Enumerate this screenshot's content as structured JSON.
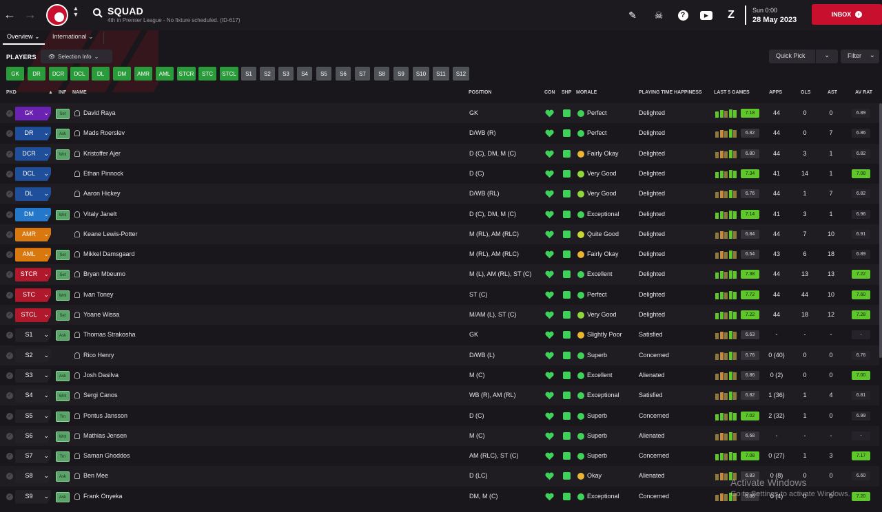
{
  "header": {
    "title": "SQUAD",
    "subtitle": "4th in Premier League - No fixture scheduled. (ID-617)",
    "day_time": "Sun 0:00",
    "date": "28 May 2023",
    "inbox_label": "INBOX"
  },
  "tabs": [
    {
      "label": "Overview"
    },
    {
      "label": "International"
    }
  ],
  "players_label": "PLAYERS",
  "selection_info": "Selection Info",
  "quick_pick": "Quick Pick",
  "filter": "Filter",
  "chips": [
    "GK",
    "DR",
    "DCR",
    "DCL",
    "DL",
    "DM",
    "AMR",
    "AML",
    "STCR",
    "STC",
    "STCL",
    "S1",
    "S2",
    "S3",
    "S4",
    "S5",
    "S6",
    "S7",
    "S8",
    "S9",
    "S10",
    "S11",
    "S12"
  ],
  "columns": {
    "pkd": "PKD",
    "inf": "INF",
    "name": "NAME",
    "position": "POSITION",
    "con": "CON",
    "shp": "SHP",
    "morale": "MORALE",
    "pth": "PLAYING TIME HAPPINESS",
    "last5": "LAST 5 GAMES",
    "apps": "APPS",
    "gls": "GLS",
    "ast": "AST",
    "avrat": "AV RAT"
  },
  "players": [
    {
      "role": "GK",
      "role_color": "#6a22b3",
      "inf": "Set",
      "name": "David Raya",
      "position": "GK",
      "morale": "Perfect",
      "mor_color": "#3fd25a",
      "pth": "Delighted",
      "last5": "7.18",
      "last5_hi": true,
      "apps": "44",
      "gls": "0",
      "ast": "0",
      "avrat": "6.89",
      "avrat_hi": false
    },
    {
      "role": "DR",
      "role_color": "#1f4f9a",
      "inf": "Ask",
      "name": "Mads Roerslev",
      "position": "D/WB (R)",
      "morale": "Perfect",
      "mor_color": "#3fd25a",
      "pth": "Delighted",
      "last5": "6.82",
      "last5_hi": false,
      "apps": "44",
      "gls": "0",
      "ast": "7",
      "avrat": "6.86",
      "avrat_hi": false
    },
    {
      "role": "DCR",
      "role_color": "#1f4f9a",
      "inf": "Wnt",
      "name": "Kristoffer Ajer",
      "position": "D (C), DM, M (C)",
      "morale": "Fairly Okay",
      "mor_color": "#e9b533",
      "pth": "Delighted",
      "last5": "6.80",
      "last5_hi": false,
      "apps": "44",
      "gls": "3",
      "ast": "1",
      "avrat": "6.82",
      "avrat_hi": false
    },
    {
      "role": "DCL",
      "role_color": "#1f4f9a",
      "inf": "",
      "name": "Ethan Pinnock",
      "position": "D (C)",
      "morale": "Very Good",
      "mor_color": "#8fd63a",
      "pth": "Delighted",
      "last5": "7.34",
      "last5_hi": true,
      "apps": "41",
      "gls": "14",
      "ast": "1",
      "avrat": "7.08",
      "avrat_hi": true
    },
    {
      "role": "DL",
      "role_color": "#1f4f9a",
      "inf": "",
      "name": "Aaron Hickey",
      "position": "D/WB (RL)",
      "morale": "Very Good",
      "mor_color": "#8fd63a",
      "pth": "Delighted",
      "last5": "6.76",
      "last5_hi": false,
      "apps": "44",
      "gls": "1",
      "ast": "7",
      "avrat": "6.82",
      "avrat_hi": false
    },
    {
      "role": "DM",
      "role_color": "#2577c9",
      "inf": "Wnt",
      "name": "Vitaly Janelt",
      "position": "D (C), DM, M (C)",
      "morale": "Exceptional",
      "mor_color": "#3fd25a",
      "pth": "Delighted",
      "last5": "7.14",
      "last5_hi": true,
      "apps": "41",
      "gls": "3",
      "ast": "1",
      "avrat": "6.96",
      "avrat_hi": false
    },
    {
      "role": "AMR",
      "role_color": "#d9780e",
      "inf": "",
      "name": "Keane Lewis-Potter",
      "position": "M (RL), AM (RLC)",
      "morale": "Quite Good",
      "mor_color": "#c9d636",
      "pth": "Delighted",
      "last5": "6.84",
      "last5_hi": false,
      "apps": "44",
      "gls": "7",
      "ast": "10",
      "avrat": "6.91",
      "avrat_hi": false
    },
    {
      "role": "AML",
      "role_color": "#d9780e",
      "inf": "Set",
      "name": "Mikkel Damsgaard",
      "position": "M (RL), AM (RLC)",
      "morale": "Fairly Okay",
      "mor_color": "#e9b533",
      "pth": "Delighted",
      "last5": "6.54",
      "last5_hi": false,
      "apps": "43",
      "gls": "6",
      "ast": "18",
      "avrat": "6.89",
      "avrat_hi": false
    },
    {
      "role": "STCR",
      "role_color": "#b0182c",
      "inf": "Set",
      "name": "Bryan Mbeumo",
      "position": "M (L), AM (RL), ST (C)",
      "morale": "Excellent",
      "mor_color": "#3fd25a",
      "pth": "Delighted",
      "last5": "7.38",
      "last5_hi": true,
      "apps": "44",
      "gls": "13",
      "ast": "13",
      "avrat": "7.22",
      "avrat_hi": true
    },
    {
      "role": "STC",
      "role_color": "#b0182c",
      "inf": "Wnt",
      "name": "Ivan Toney",
      "position": "ST (C)",
      "morale": "Perfect",
      "mor_color": "#3fd25a",
      "pth": "Delighted",
      "last5": "7.72",
      "last5_hi": true,
      "apps": "44",
      "gls": "44",
      "ast": "10",
      "avrat": "7.60",
      "avrat_hi": true
    },
    {
      "role": "STCL",
      "role_color": "#b0182c",
      "inf": "Set",
      "name": "Yoane Wissa",
      "position": "M/AM (L), ST (C)",
      "morale": "Very Good",
      "mor_color": "#8fd63a",
      "pth": "Delighted",
      "last5": "7.22",
      "last5_hi": true,
      "apps": "44",
      "gls": "18",
      "ast": "12",
      "avrat": "7.28",
      "avrat_hi": true
    },
    {
      "role": "S1",
      "role_color": "",
      "inf": "Ask",
      "name": "Thomas Strakosha",
      "position": "GK",
      "morale": "Slightly Poor",
      "mor_color": "#e9b533",
      "pth": "Satisfied",
      "last5": "6.63",
      "last5_hi": false,
      "apps": "-",
      "gls": "-",
      "ast": "-",
      "avrat": "-",
      "avrat_hi": false
    },
    {
      "role": "S2",
      "role_color": "",
      "inf": "",
      "name": "Rico Henry",
      "position": "D/WB (L)",
      "morale": "Superb",
      "mor_color": "#3fd25a",
      "pth": "Concerned",
      "last5": "6.76",
      "last5_hi": false,
      "apps": "0 (40)",
      "gls": "0",
      "ast": "0",
      "avrat": "6.76",
      "avrat_hi": false
    },
    {
      "role": "S3",
      "role_color": "",
      "inf": "Ask",
      "name": "Josh Dasilva",
      "position": "M (C)",
      "morale": "Excellent",
      "mor_color": "#3fd25a",
      "pth": "Alienated",
      "last5": "6.86",
      "last5_hi": false,
      "apps": "0 (2)",
      "gls": "0",
      "ast": "0",
      "avrat": "7.00",
      "avrat_hi": true
    },
    {
      "role": "S4",
      "role_color": "",
      "inf": "Wnt",
      "name": "Sergi Canos",
      "position": "WB (R), AM (RL)",
      "morale": "Exceptional",
      "mor_color": "#3fd25a",
      "pth": "Satisfied",
      "last5": "6.82",
      "last5_hi": false,
      "apps": "1 (36)",
      "gls": "1",
      "ast": "4",
      "avrat": "6.81",
      "avrat_hi": false
    },
    {
      "role": "S5",
      "role_color": "",
      "inf": "Trn",
      "name": "Pontus Jansson",
      "position": "D (C)",
      "morale": "Superb",
      "mor_color": "#3fd25a",
      "pth": "Concerned",
      "last5": "7.02",
      "last5_hi": true,
      "apps": "2 (32)",
      "gls": "1",
      "ast": "0",
      "avrat": "6.99",
      "avrat_hi": false
    },
    {
      "role": "S6",
      "role_color": "",
      "inf": "Wnt",
      "name": "Mathias Jensen",
      "position": "M (C)",
      "morale": "Superb",
      "mor_color": "#3fd25a",
      "pth": "Alienated",
      "last5": "6.68",
      "last5_hi": false,
      "apps": "-",
      "gls": "-",
      "ast": "-",
      "avrat": "-",
      "avrat_hi": false
    },
    {
      "role": "S7",
      "role_color": "",
      "inf": "Trn",
      "name": "Saman Ghoddos",
      "position": "AM (RLC), ST (C)",
      "morale": "Superb",
      "mor_color": "#3fd25a",
      "pth": "Concerned",
      "last5": "7.08",
      "last5_hi": true,
      "apps": "0 (27)",
      "gls": "1",
      "ast": "3",
      "avrat": "7.17",
      "avrat_hi": true
    },
    {
      "role": "S8",
      "role_color": "",
      "inf": "Ask",
      "name": "Ben Mee",
      "position": "D (LC)",
      "morale": "Okay",
      "mor_color": "#e9b533",
      "pth": "Alienated",
      "last5": "6.83",
      "last5_hi": false,
      "apps": "0 (8)",
      "gls": "0",
      "ast": "0",
      "avrat": "6.60",
      "avrat_hi": false
    },
    {
      "role": "S9",
      "role_color": "",
      "inf": "Ask",
      "name": "Frank Onyeka",
      "position": "DM, M (C)",
      "morale": "Exceptional",
      "mor_color": "#3fd25a",
      "pth": "Concerned",
      "last5": "6.86",
      "last5_hi": false,
      "apps": "0 (4)",
      "gls": "0",
      "ast": "0",
      "avrat": "7.20",
      "avrat_hi": true
    }
  ],
  "watermark": {
    "line1": "Activate Windows",
    "line2": "Go to Settings to activate Windows."
  },
  "colors": {
    "accent_red": "#c8102e",
    "chip_green": "#2a9b3a",
    "chip_grey": "#4f5257",
    "rating_hi": "#5fc62b"
  }
}
